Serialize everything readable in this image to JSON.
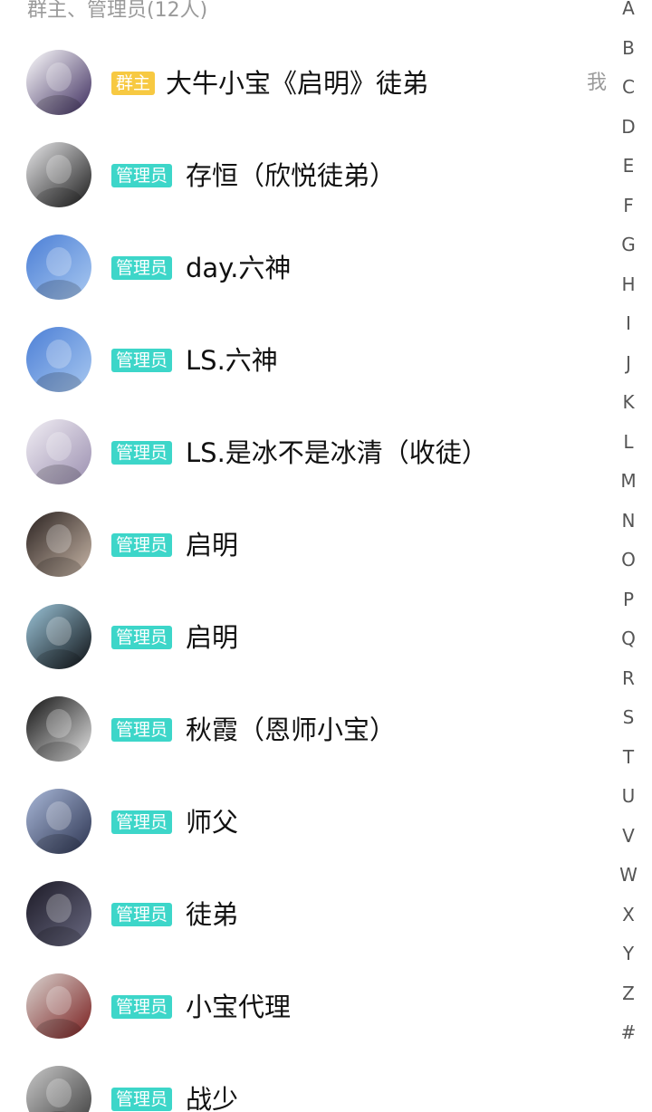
{
  "section_title": "群主、管理员(12人)",
  "me_label": "我",
  "members": [
    {
      "role": "群主",
      "name": "大牛小宝《启明》徒弟",
      "badge_type": "owner",
      "avatar_colors": [
        "#ffffff",
        "#3b2a5c"
      ]
    },
    {
      "role": "管理员",
      "name": "存恒（欣悦徒弟）",
      "badge_type": "admin",
      "avatar_colors": [
        "#e8e8ea",
        "#1a1a1a"
      ]
    },
    {
      "role": "管理员",
      "name": "day.六神",
      "badge_type": "admin",
      "avatar_colors": [
        "#4c7fd6",
        "#a8c8f0"
      ]
    },
    {
      "role": "管理员",
      "name": "LS.六神",
      "badge_type": "admin",
      "avatar_colors": [
        "#4c7fd6",
        "#a8c8f0"
      ]
    },
    {
      "role": "管理员",
      "name": "LS.是冰不是冰清（收徒）",
      "badge_type": "admin",
      "avatar_colors": [
        "#f1eef4",
        "#9b8fb0"
      ]
    },
    {
      "role": "管理员",
      "name": "启明",
      "badge_type": "admin",
      "avatar_colors": [
        "#2a2220",
        "#c9b7a8"
      ]
    },
    {
      "role": "管理员",
      "name": "启明",
      "badge_type": "admin",
      "avatar_colors": [
        "#9bc4d8",
        "#0d1014"
      ]
    },
    {
      "role": "管理员",
      "name": "秋霞（恩师小宝）",
      "badge_type": "admin",
      "avatar_colors": [
        "#111111",
        "#e6e6e6"
      ]
    },
    {
      "role": "管理员",
      "name": "师父",
      "badge_type": "admin",
      "avatar_colors": [
        "#a9b8d8",
        "#2b3350"
      ]
    },
    {
      "role": "管理员",
      "name": "徒弟",
      "badge_type": "admin",
      "avatar_colors": [
        "#1c1a26",
        "#6a6a82"
      ]
    },
    {
      "role": "管理员",
      "name": "小宝代理",
      "badge_type": "admin",
      "avatar_colors": [
        "#d9d4d0",
        "#7a1e1e"
      ]
    },
    {
      "role": "管理员",
      "name": "战少",
      "badge_type": "admin",
      "avatar_colors": [
        "#c8c8c8",
        "#3a3a3a"
      ]
    }
  ],
  "alphabet_index": [
    "A",
    "B",
    "C",
    "D",
    "E",
    "F",
    "G",
    "H",
    "I",
    "J",
    "K",
    "L",
    "M",
    "N",
    "O",
    "P",
    "Q",
    "R",
    "S",
    "T",
    "U",
    "V",
    "W",
    "X",
    "Y",
    "Z",
    "#"
  ],
  "colors": {
    "owner_badge": "#f7c942",
    "admin_badge": "#3dd6c9",
    "secondary_text": "#9a9a9a"
  }
}
